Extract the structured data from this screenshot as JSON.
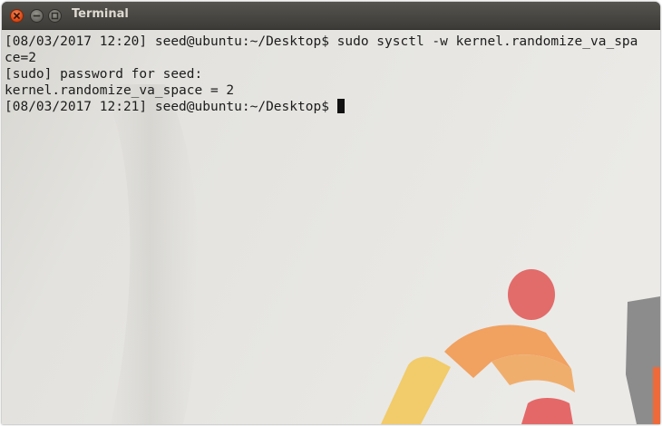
{
  "window": {
    "title": "Terminal",
    "buttons": {
      "close_icon": "close-icon",
      "minimize_icon": "minimize-icon",
      "maximize_icon": "maximize-icon"
    }
  },
  "terminal": {
    "lines": [
      "[08/03/2017 12:20] seed@ubuntu:~/Desktop$ sudo sysctl -w kernel.randomize_va_spa",
      "ce=2",
      "[sudo] password for seed:",
      "kernel.randomize_va_space = 2",
      "[08/03/2017 12:21] seed@ubuntu:~/Desktop$"
    ]
  },
  "colors": {
    "titlebar": "#3c3b37",
    "title_text": "#dfdbd2",
    "close_button": "#df4a16",
    "terminal_text": "#1c1c1c",
    "background": "#e5e4e0"
  }
}
